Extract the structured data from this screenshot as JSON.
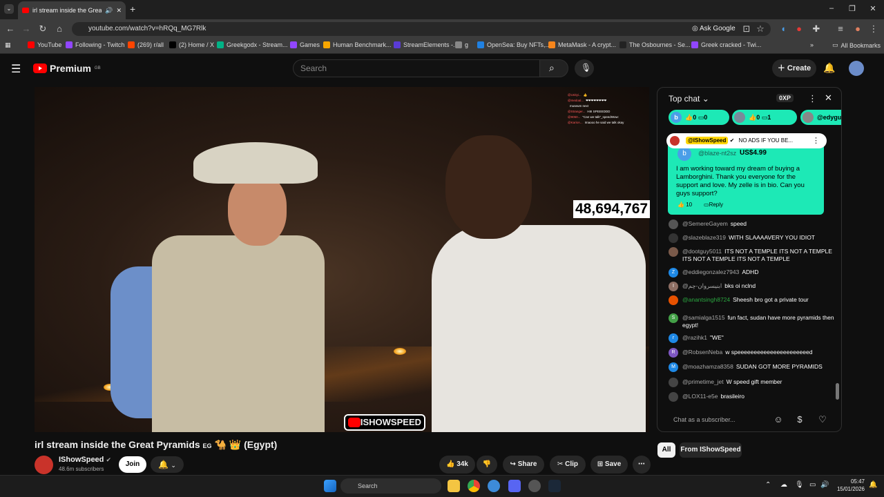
{
  "browser": {
    "tab_title": "irl stream inside the Great P",
    "url": "youtube.com/watch?v=hRQq_MG7Rlk",
    "ask_google": "Ask Google",
    "all_bookmarks": "All Bookmarks",
    "bookmarks": [
      {
        "label": "YouTube",
        "color": "#ff0000"
      },
      {
        "label": "Following - Twitch",
        "color": "#9146ff"
      },
      {
        "label": "(269) r/all",
        "color": "#ff4500"
      },
      {
        "label": "(2) Home / X",
        "color": "#000000"
      },
      {
        "label": "Greekgodx - Stream...",
        "color": "#00b386"
      },
      {
        "label": "Games",
        "color": "#9146ff"
      },
      {
        "label": "Human Benchmark...",
        "color": "#f7a600"
      },
      {
        "label": "StreamElements -...",
        "color": "#5a3bd6"
      },
      {
        "label": "g",
        "color": "#888888"
      },
      {
        "label": "OpenSea: Buy NFTs,...",
        "color": "#2081e2"
      },
      {
        "label": "MetaMask - A crypt...",
        "color": "#f6851b"
      },
      {
        "label": "The Osbournes - Se...",
        "color": "#222222"
      },
      {
        "label": "Greek cracked - Twi...",
        "color": "#9146ff"
      }
    ]
  },
  "youtube": {
    "logo_text": "Premium",
    "logo_region": "GB",
    "search_placeholder": "Search",
    "create_label": "Create"
  },
  "video": {
    "view_counter": "48,694,767",
    "overlay_brand": "ISHOWSPEED",
    "overlay_chat": [
      {
        "user": "@Unityi...",
        "text": "👍"
      },
      {
        "user": "@medoal...",
        "text": "❤❤❤❤❤❤❤❤"
      },
      {
        "user": "",
        "text": "museum next"
      },
      {
        "user": "@Stranger...",
        "text": "HIII SPEEEDDD"
      },
      {
        "user": "@9050...",
        "text": "\"Can we talk\"_speedWow:"
      },
      {
        "user": "@KarisA...",
        "text": "Imaooo he said we talk okay"
      }
    ],
    "title": "irl stream inside the Great Pyramids",
    "title_suffix": "(Egypt)",
    "title_flag": "EG",
    "channel": "IShowSpeed",
    "subscribers": "48.6m subscribers",
    "join_label": "Join",
    "likes": "34k",
    "share_label": "Share",
    "clip_label": "Clip",
    "save_label": "Save"
  },
  "chat": {
    "header": "Top chat",
    "xp": "0XP",
    "tickers": [
      {
        "avatar": "b",
        "likes": "0",
        "replies": "0",
        "color": "#1de9b6"
      },
      {
        "avatar": "",
        "likes": "0",
        "replies": "1",
        "color": "#1de9b6"
      },
      {
        "avatar": "",
        "user": "@edyguo",
        "color": "#1de9b6"
      }
    ],
    "pinned": {
      "user": "@IShowSpeed",
      "text": "NO ADS IF YOU BE..."
    },
    "superchat": {
      "avatar": "b",
      "user": "@blaze-nt2sz",
      "amount": "US$4.99",
      "message": "I am working toward my dream of buying a Lamborghini. Thank you everyone for the support and love. My zelle is in bio. Can you guys support?",
      "likes": "10",
      "reply": "Reply"
    },
    "messages": [
      {
        "avatar": "",
        "user": "@SemereGayem",
        "text": "speed",
        "color": "#555555"
      },
      {
        "avatar": "",
        "user": "@slazeblaze319",
        "text": "WITH SLAAAAVERY YOU IDIOT",
        "color": "#333333"
      },
      {
        "avatar": "",
        "user": "@dootguy5011",
        "text": "ITS NOT A TEMPLE ITS NOT A TEMPLE ITS NOT A TEMPLE ITS NOT A TEMPLE",
        "color": "#7a5a4a"
      },
      {
        "avatar": "Z",
        "user": "@eddiegonzalez7943",
        "text": "ADHD",
        "color": "#1e88e5"
      },
      {
        "avatar": "I",
        "user": "@ابنیسروان-چم",
        "text": "bks oi nclnd",
        "color": "#8d6e63"
      },
      {
        "avatar": "",
        "user": "@anantsingh8724",
        "text": "Sheesh bro got a private tour",
        "color": "#e65100"
      },
      {
        "avatar": "S",
        "user": "@samialga1515",
        "text": "fun fact, sudan have more pyramids then egypt!",
        "color": "#43a047"
      },
      {
        "avatar": "r",
        "user": "@razihk1",
        "text": "\"WE\"",
        "color": "#1e88e5"
      },
      {
        "avatar": "R",
        "user": "@RobsenNeba",
        "text": "w speeeeeeeeeeeeeeeeeeeeeed",
        "color": "#7e57c2"
      },
      {
        "avatar": "M",
        "user": "@moazhamza8358",
        "text": "SUDAN GOT MORE PYRAMIDS",
        "color": "#1e88e5"
      },
      {
        "avatar": "",
        "user": "@primetime_jet",
        "text": "W speed gift member",
        "color": "#444444"
      },
      {
        "avatar": "",
        "user": "@LOX11-e5e",
        "text": "brasileiro",
        "color": "#444444"
      }
    ],
    "input_placeholder": "Chat as a subscriber...",
    "filters": {
      "all": "All",
      "from": "From IShowSpeed"
    }
  },
  "taskbar": {
    "search": "Search",
    "time": "05:47",
    "date": "15/01/2026"
  }
}
